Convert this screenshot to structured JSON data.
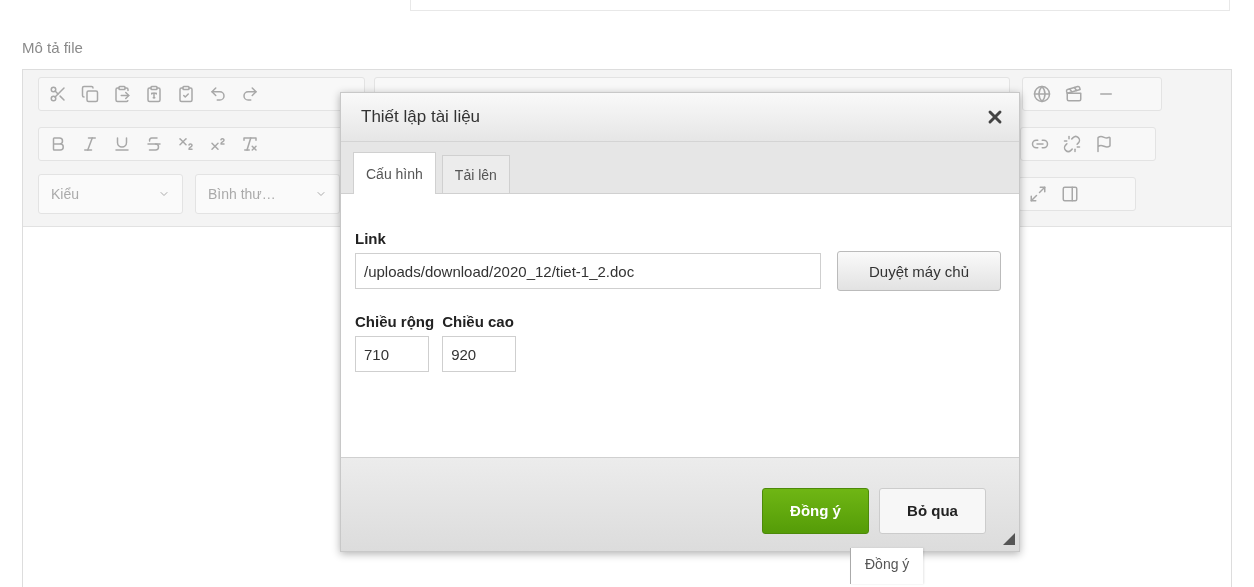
{
  "field_label": "Mô tả file",
  "toolbar": {
    "dropdowns": [
      {
        "label": "Kiểu"
      },
      {
        "label": "Bình thư…"
      }
    ]
  },
  "dialog": {
    "title": "Thiết lập tài liệu",
    "tabs": [
      {
        "label": "Cấu hình",
        "selected": true
      },
      {
        "label": "Tải lên",
        "selected": false
      }
    ],
    "link": {
      "label": "Link",
      "value": "/uploads/download/2020_12/tiet-1_2.doc",
      "browse_button": "Duyệt máy chủ"
    },
    "size_fields": [
      {
        "label": "Chiều rộng",
        "value": "710"
      },
      {
        "label": "Chiều cao",
        "value": "920"
      }
    ],
    "buttons": [
      {
        "label": "Đồng ý",
        "kind": "primary"
      },
      {
        "label": "Bỏ qua",
        "kind": "secondary"
      }
    ]
  },
  "tooltip": "Đồng ý"
}
